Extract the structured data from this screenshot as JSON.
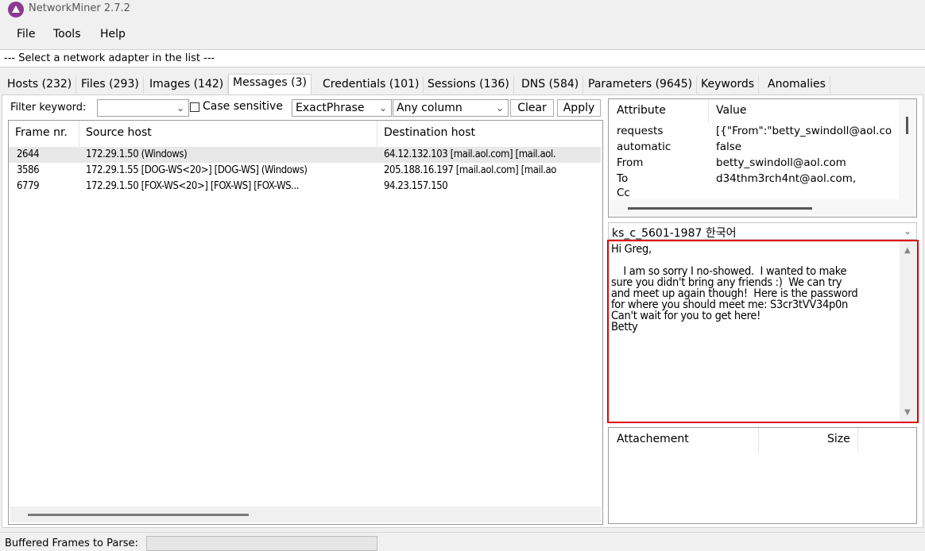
{
  "window": {
    "title": "NetworkMiner 2.7.2"
  },
  "menu": {
    "file": "File",
    "tools": "Tools",
    "help": "Help"
  },
  "adapter": {
    "text": "--- Select a network adapter in the list ---"
  },
  "tabs": [
    {
      "label": "Hosts (232)"
    },
    {
      "label": "Files (293)"
    },
    {
      "label": "Images (142)"
    },
    {
      "label": "Messages (3)"
    },
    {
      "label": "Credentials (101)"
    },
    {
      "label": "Sessions (136)"
    },
    {
      "label": "DNS (584)"
    },
    {
      "label": "Parameters (9645)"
    },
    {
      "label": "Keywords"
    },
    {
      "label": "Anomalies"
    }
  ],
  "filter": {
    "label": "Filter keyword:",
    "keyword_value": "",
    "case_sensitive_label": "Case sensitive",
    "match_mode": "ExactPhrase",
    "column": "Any column",
    "clear_label": "Clear",
    "apply_label": "Apply"
  },
  "messages_table": {
    "headers": [
      "Frame nr.",
      "Source host",
      "Destination host"
    ],
    "rows": [
      {
        "frame": "2644",
        "source": "172.29.1.50 (Windows)",
        "destination": "64.12.132.103 [mail.aol.com] [mail.aol."
      },
      {
        "frame": "3586",
        "source": "172.29.1.55 [DOG-WS<20>] [DOG-WS] (Windows)",
        "destination": "205.188.16.197 [mail.aol.com] [mail.ao"
      },
      {
        "frame": "6779",
        "source": "172.29.1.50 [FOX-WS<20>] [FOX-WS] [FOX-WS...",
        "destination": "94.23.157.150"
      }
    ]
  },
  "attributes": {
    "headers": [
      "Attribute",
      "Value"
    ],
    "rows": [
      {
        "attr": "requests",
        "value": "[{\"From\":\"betty_swindoll@aol.co"
      },
      {
        "attr": "automatic",
        "value": "false"
      },
      {
        "attr": "From",
        "value": "betty_swindoll@aol.com"
      },
      {
        "attr": "To",
        "value": "d34thm3rch4nt@aol.com,"
      },
      {
        "attr": "Cc",
        "value": ""
      }
    ]
  },
  "encoding": {
    "selected": "ks_c_5601-1987 한국어"
  },
  "message_body": "Hi Greg,\n\n    I am so sorry I no-showed.  I wanted to make\nsure you didn't bring any friends :)  We can try\nand meet up again though!  Here is the password\nfor where you should meet me: S3cr3tVV34p0n\nCan't wait for you to get here!\nBetty",
  "attachments": {
    "headers": [
      "Attachement",
      "Size"
    ]
  },
  "status": {
    "label": "Buffered Frames to Parse:",
    "progress": 0
  },
  "colors": {
    "highlight_border": "#e00000",
    "logo": "#8b3a8f"
  }
}
